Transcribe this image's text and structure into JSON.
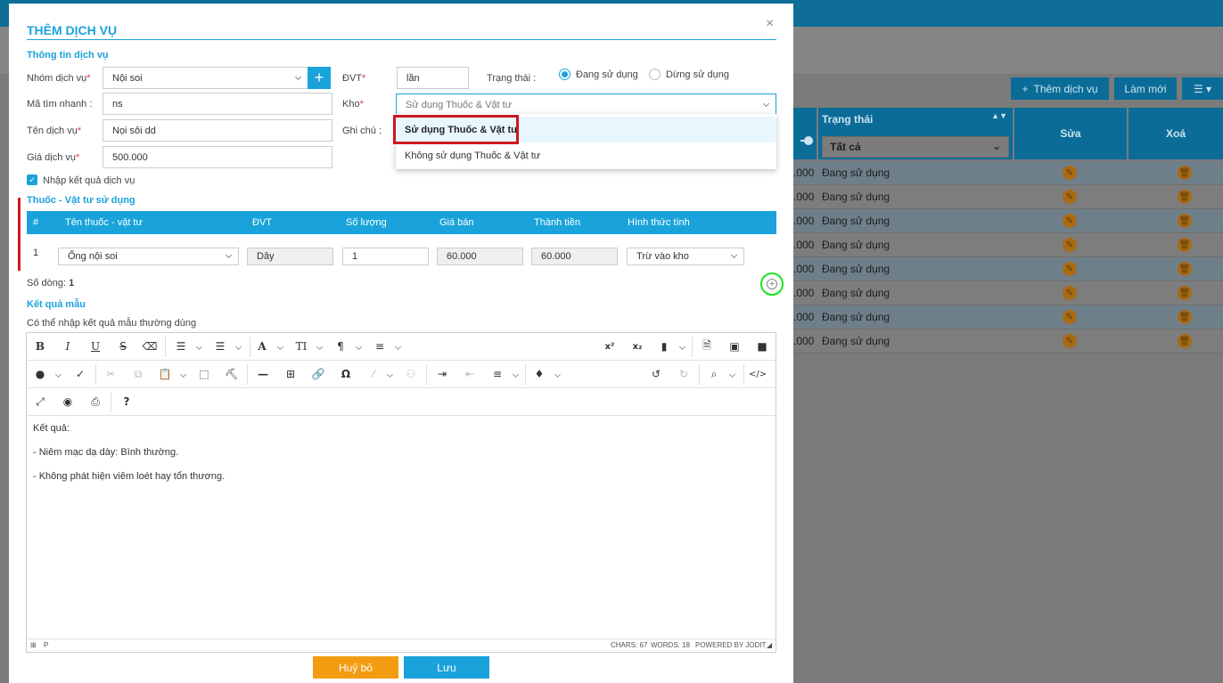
{
  "background": {
    "add_service_label": "Thêm dịch vụ",
    "refresh_label": "Làm mới",
    "col_status": "Trạng thái",
    "col_edit": "Sửa",
    "col_delete": "Xoá",
    "status_filter": "Tất cả",
    "rows": [
      {
        "price": ".000",
        "status": "Đang sử dụng"
      },
      {
        "price": ".000",
        "status": "Đang sử dụng"
      },
      {
        "price": ".000",
        "status": "Đang sử dụng"
      },
      {
        "price": ".000",
        "status": "Đang sử dụng"
      },
      {
        "price": ".000",
        "status": "Đang sử dụng"
      },
      {
        "price": ".000",
        "status": "Đang sử dụng"
      },
      {
        "price": ".000",
        "status": "Đang sử dụng"
      },
      {
        "price": ".000",
        "status": "Đang sử dụng"
      }
    ]
  },
  "modal": {
    "title": "THÊM DỊCH VỤ",
    "close": "×",
    "section_info": "Thông tin dịch vụ",
    "group_label": "Nhóm dịch vụ",
    "group_value": "Nội soi",
    "add_group": "+",
    "quick_code_label": "Mã tìm nhanh :",
    "quick_code_value": "ns",
    "name_label": "Tên dịch vụ",
    "name_value": "Nọi sôi dd",
    "price_label": "Giá dịch vụ",
    "price_value": "500.000",
    "unit_label": "ĐVT",
    "unit_value": "lần",
    "status_label": "Trạng thái :",
    "status_active": "Đang sử dụng",
    "status_inactive": "Dừng sử dụng",
    "warehouse_label": "Kho",
    "warehouse_value": "Sử dụng Thuốc & Vật tư",
    "note_label": "Ghi chú :",
    "warehouse_options": [
      "Sử dụng Thuốc & Vật tư",
      "Không sử dụng Thuốc & Vật tư"
    ],
    "enter_result_label": "Nhập kết quả dịch vụ",
    "section_supplies": "Thuốc - Vật tư sử dụng",
    "table_headers": [
      "#",
      "Tên thuốc - vật tư",
      "ĐVT",
      "Số lượng",
      "Giá bán",
      "Thành tiền",
      "Hình thức tính"
    ],
    "table_row": {
      "index": "1",
      "name": "Ống nội soi",
      "unit": "Dây",
      "qty": "1",
      "price": "60.000",
      "total": "60.000",
      "method": "Trừ vào kho"
    },
    "row_count_label": "Số dòng:",
    "row_count_value": "1",
    "section_result": "Kết quả mẫu",
    "result_hint": "Có thể nhập kết quả mẫu thường dùng",
    "editor_lines": [
      "Kết quả:",
      "- Niêm mạc dạ dày: Bình thường.",
      "- Không phát hiện viêm loét hay tổn thương."
    ],
    "editor_status": {
      "paragraph": "P",
      "chars": "CHARS: 67",
      "words": "WORDS: 18",
      "powered": "POWERED BY JODIT"
    },
    "cancel_label": "Huỷ bỏ",
    "save_label": "Lưu"
  },
  "colors": {
    "accent": "#1aa3da",
    "cancel": "#f39c12",
    "required": "#e53935",
    "highlight": "#d0181f",
    "add_row_circle": "#19e619"
  }
}
